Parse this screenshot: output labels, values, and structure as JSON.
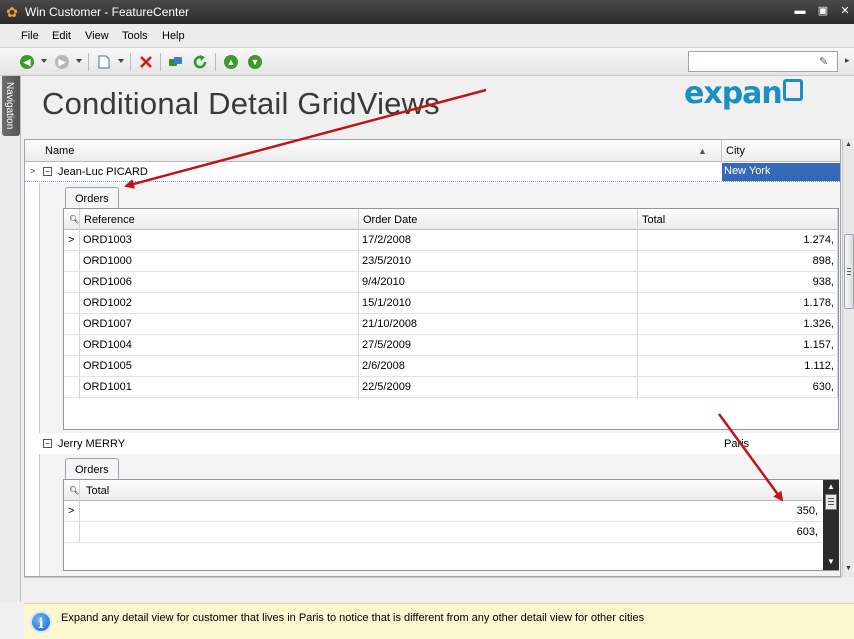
{
  "window": {
    "title": "Win Customer - FeatureCenter",
    "minimize_glyph": "▬",
    "restore_glyph": "▣",
    "close_glyph": "✕"
  },
  "menu": {
    "items": [
      "File",
      "Edit",
      "View",
      "Tools",
      "Help"
    ]
  },
  "navigation_label": "Navigation",
  "page": {
    "heading": "Conditional Detail GridViews",
    "logo_text": "expan"
  },
  "grid": {
    "columns": {
      "name": "Name",
      "city": "City"
    },
    "customers": [
      {
        "name": "Jean-Luc PICARD",
        "city": "New York",
        "detail_tab": "Orders",
        "detail_columns": [
          "Reference",
          "Order Date",
          "Total"
        ],
        "orders": [
          {
            "reference": "ORD1003",
            "date": "17/2/2008",
            "total": "1.274,"
          },
          {
            "reference": "ORD1000",
            "date": "23/5/2010",
            "total": "898,"
          },
          {
            "reference": "ORD1006",
            "date": "9/4/2010",
            "total": "938,"
          },
          {
            "reference": "ORD1002",
            "date": "15/1/2010",
            "total": "1.178,"
          },
          {
            "reference": "ORD1007",
            "date": "21/10/2008",
            "total": "1.326,"
          },
          {
            "reference": "ORD1004",
            "date": "27/5/2009",
            "total": "1.157,"
          },
          {
            "reference": "ORD1005",
            "date": "2/6/2008",
            "total": "1.112,"
          },
          {
            "reference": "ORD1001",
            "date": "22/5/2009",
            "total": "630,"
          }
        ]
      },
      {
        "name": "Jerry MERRY",
        "city": "Paris",
        "detail_tab": "Orders",
        "detail_columns": [
          "Total"
        ],
        "orders": [
          {
            "total": "350,"
          },
          {
            "total": "603,"
          }
        ]
      }
    ]
  },
  "info": {
    "message": "Expand any detail view for customer that lives in Paris to notice that is different from any other detail view for other cities"
  },
  "colors": {
    "accent": "#3569b8",
    "logo": "#1b8ec4",
    "annotation_arrow": "#c0141a",
    "info_bg": "#fbf7cf"
  }
}
